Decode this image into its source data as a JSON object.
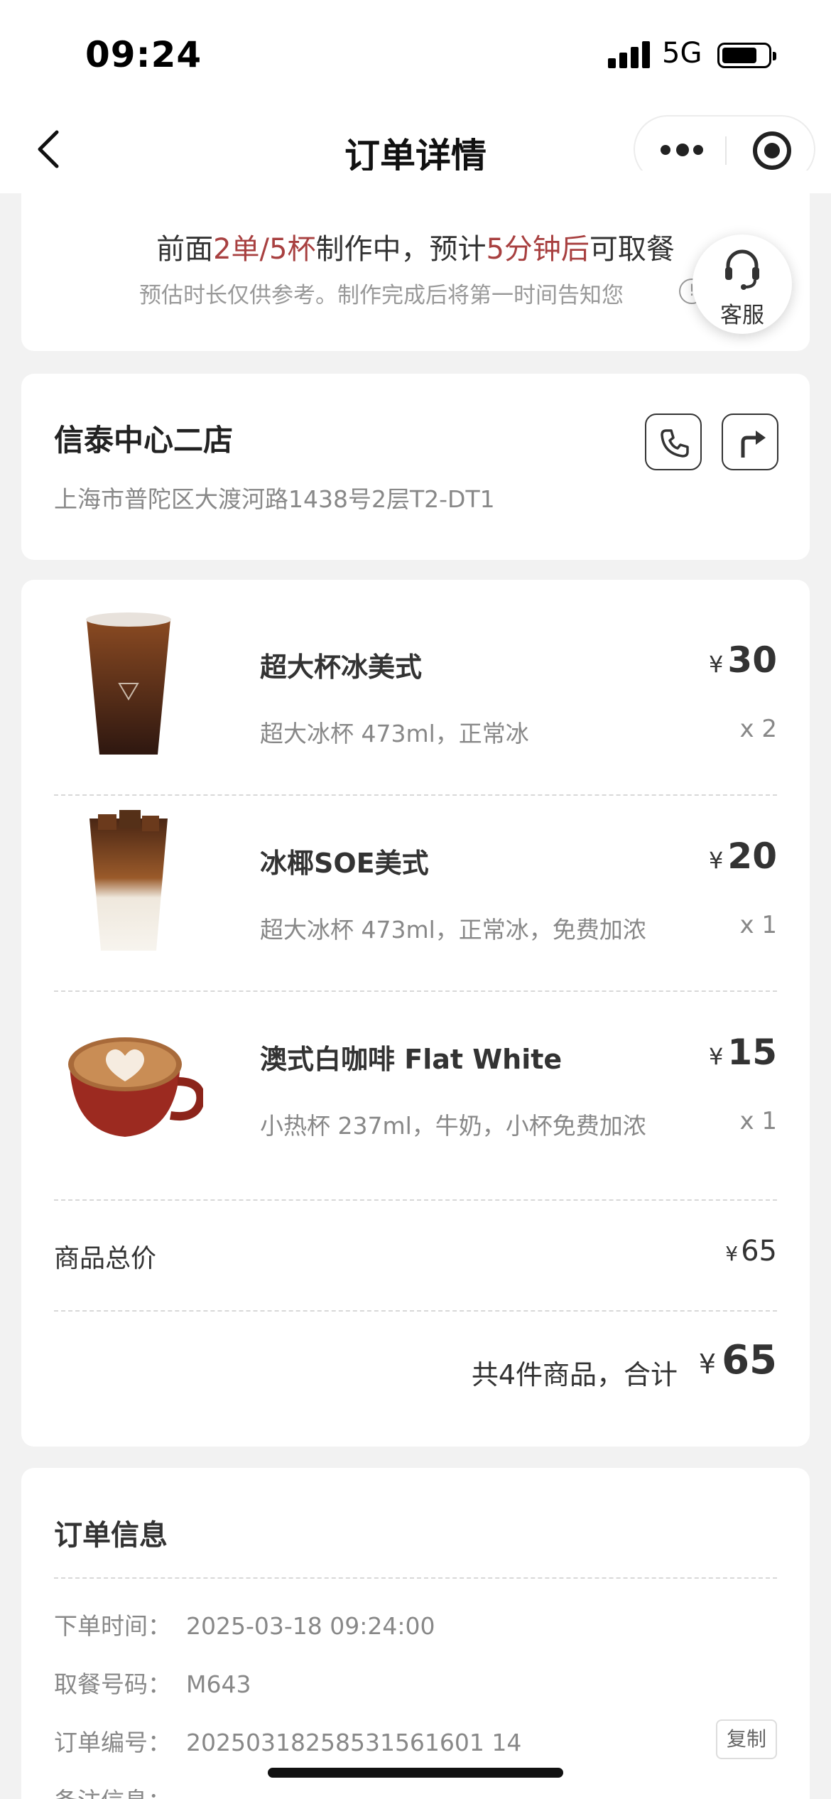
{
  "status_bar": {
    "time": "09:24",
    "network": "5G"
  },
  "nav": {
    "title": "订单详情"
  },
  "eta": {
    "prefix": "前面",
    "queue": "2单/5杯",
    "middle": "制作中，预计",
    "wait": "5分钟后",
    "suffix": "可取餐",
    "note": "预估时长仅供参考。制作完成后将第一时间告知您",
    "info_glyph": "!"
  },
  "customer_service": {
    "label": "客服"
  },
  "store": {
    "name": "信泰中心二店",
    "address": "上海市普陀区大渡河路1438号2层T2-DT1"
  },
  "items": [
    {
      "name": "超大杯冰美式",
      "spec": "超大冰杯 473ml，正常冰",
      "currency": "¥",
      "price": "30",
      "qty": "x 2"
    },
    {
      "name": "冰椰SOE美式",
      "spec": "超大冰杯 473ml，正常冰，免费加浓",
      "currency": "¥",
      "price": "20",
      "qty": "x 1"
    },
    {
      "name": "澳式白咖啡 Flat White",
      "spec": "小热杯 237ml，牛奶，小杯免费加浓",
      "currency": "¥",
      "price": "15",
      "qty": "x 1"
    }
  ],
  "summary": {
    "subtotal_label": "商品总价",
    "subtotal_currency": "¥",
    "subtotal_value": "65",
    "total_label": "共4件商品，合计",
    "total_currency": "¥",
    "total_value": "65"
  },
  "order_info": {
    "title": "订单信息",
    "rows": [
      {
        "label": "下单时间：",
        "value": "2025-03-18 09:24:00"
      },
      {
        "label": "取餐号码：",
        "value": "M643"
      },
      {
        "label": "订单编号：",
        "value": "20250318258531561601 14"
      },
      {
        "label": "备注信息：",
        "value": ""
      }
    ],
    "copy_label": "复制"
  },
  "colors": {
    "accent": "#a84040",
    "background": "#f2f2f2",
    "card": "#ffffff"
  },
  "icons": [
    "back-icon",
    "more-icon",
    "target-icon",
    "headset-icon",
    "phone-icon",
    "directions-icon",
    "info-icon"
  ]
}
